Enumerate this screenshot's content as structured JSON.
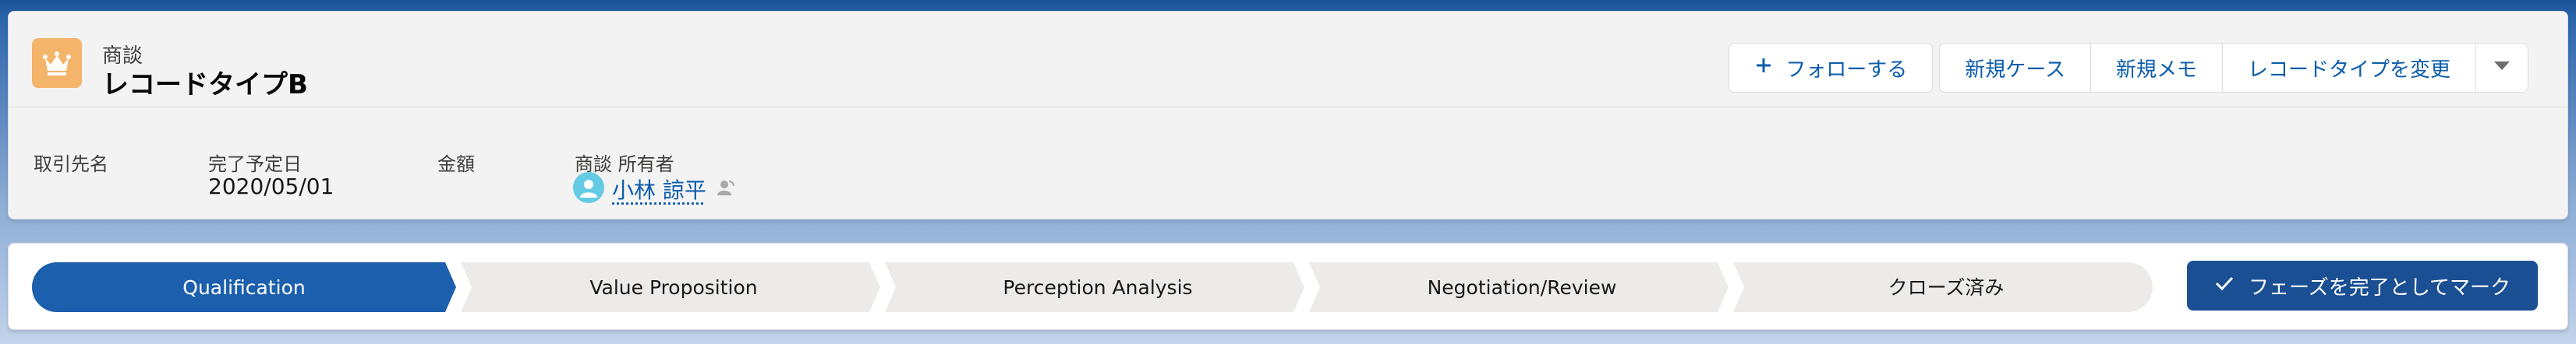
{
  "header": {
    "object_type": "商談",
    "record_title": "レコードタイプB",
    "icon": "crown-icon",
    "icon_color": "#f4b46a",
    "actions": {
      "follow_label": "フォローする",
      "new_case_label": "新規ケース",
      "new_note_label": "新規メモ",
      "change_record_type_label": "レコードタイプを変更",
      "more_icon": "chevron-down-icon"
    }
  },
  "fields": {
    "account": {
      "label": "取引先名",
      "value": ""
    },
    "close_date": {
      "label": "完了予定日",
      "value": "2020/05/01"
    },
    "amount": {
      "label": "金額",
      "value": ""
    },
    "owner": {
      "label": "商談 所有者",
      "value": "小林 諒平"
    }
  },
  "path": {
    "stages": [
      {
        "label": "Qualification",
        "active": true
      },
      {
        "label": "Value Proposition",
        "active": false
      },
      {
        "label": "Perception Analysis",
        "active": false
      },
      {
        "label": "Negotiation/Review",
        "active": false
      },
      {
        "label": "クローズ済み",
        "active": false
      }
    ],
    "active_color": "#1b5fad",
    "inactive_color": "#ecebea",
    "mark_complete_label": "フェーズを完了としてマーク"
  }
}
